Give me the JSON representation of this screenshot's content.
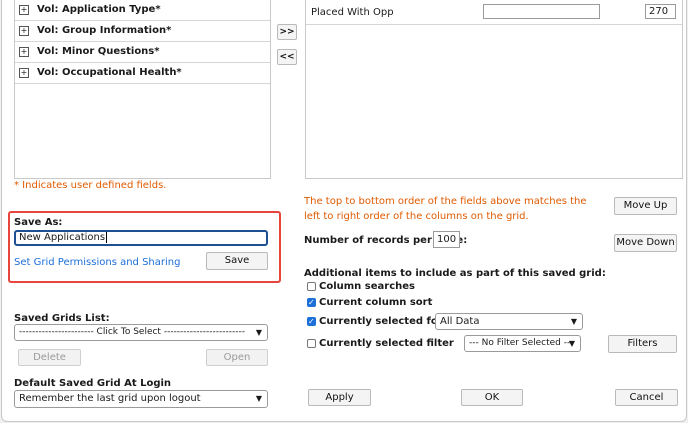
{
  "field_list": {
    "items": [
      {
        "label": "Vol: Application Type*"
      },
      {
        "label": "Vol: Group Information*"
      },
      {
        "label": "Vol: Minor Questions*"
      },
      {
        "label": "Vol: Occupational Health*"
      }
    ],
    "note": "* Indicates user defined fields."
  },
  "transfer": {
    "add_label": ">>",
    "remove_label": "<<"
  },
  "selected_fields": {
    "rows": [
      {
        "name": "Placed With Opp",
        "alias": "",
        "width": "270"
      }
    ]
  },
  "order_note": "The top to bottom order of the fields above matches the left to right order of the columns on the grid.",
  "move_up_label": "Move Up",
  "move_down_label": "Move Down",
  "save_as": {
    "title": "Save As:",
    "value": "New Applications",
    "permissions_link": "Set Grid Permissions and Sharing",
    "save_label": "Save",
    "highlight_color": "#e8453c"
  },
  "records": {
    "label": "Number of records per page:",
    "value": "100"
  },
  "saved_grids": {
    "title": "Saved Grids List:",
    "selected": "----------------------- Click To Select -------------------------",
    "delete_label": "Delete",
    "open_label": "Open"
  },
  "default_grid": {
    "title": "Default Saved Grid At Login",
    "selected": "Remember the last grid upon logout"
  },
  "additional": {
    "title": "Additional items to include as part of this saved grid:",
    "items": [
      {
        "label": "Column searches",
        "checked": false
      },
      {
        "label": "Current column sort",
        "checked": true
      },
      {
        "label": "Currently selected folder",
        "checked": true
      },
      {
        "label": "Currently selected filter",
        "checked": false
      }
    ],
    "folder_select": "All Data",
    "filter_select": "--- No Filter Selected ---",
    "filters_label": "Filters"
  },
  "footer": {
    "apply_label": "Apply",
    "ok_label": "OK",
    "cancel_label": "Cancel"
  }
}
